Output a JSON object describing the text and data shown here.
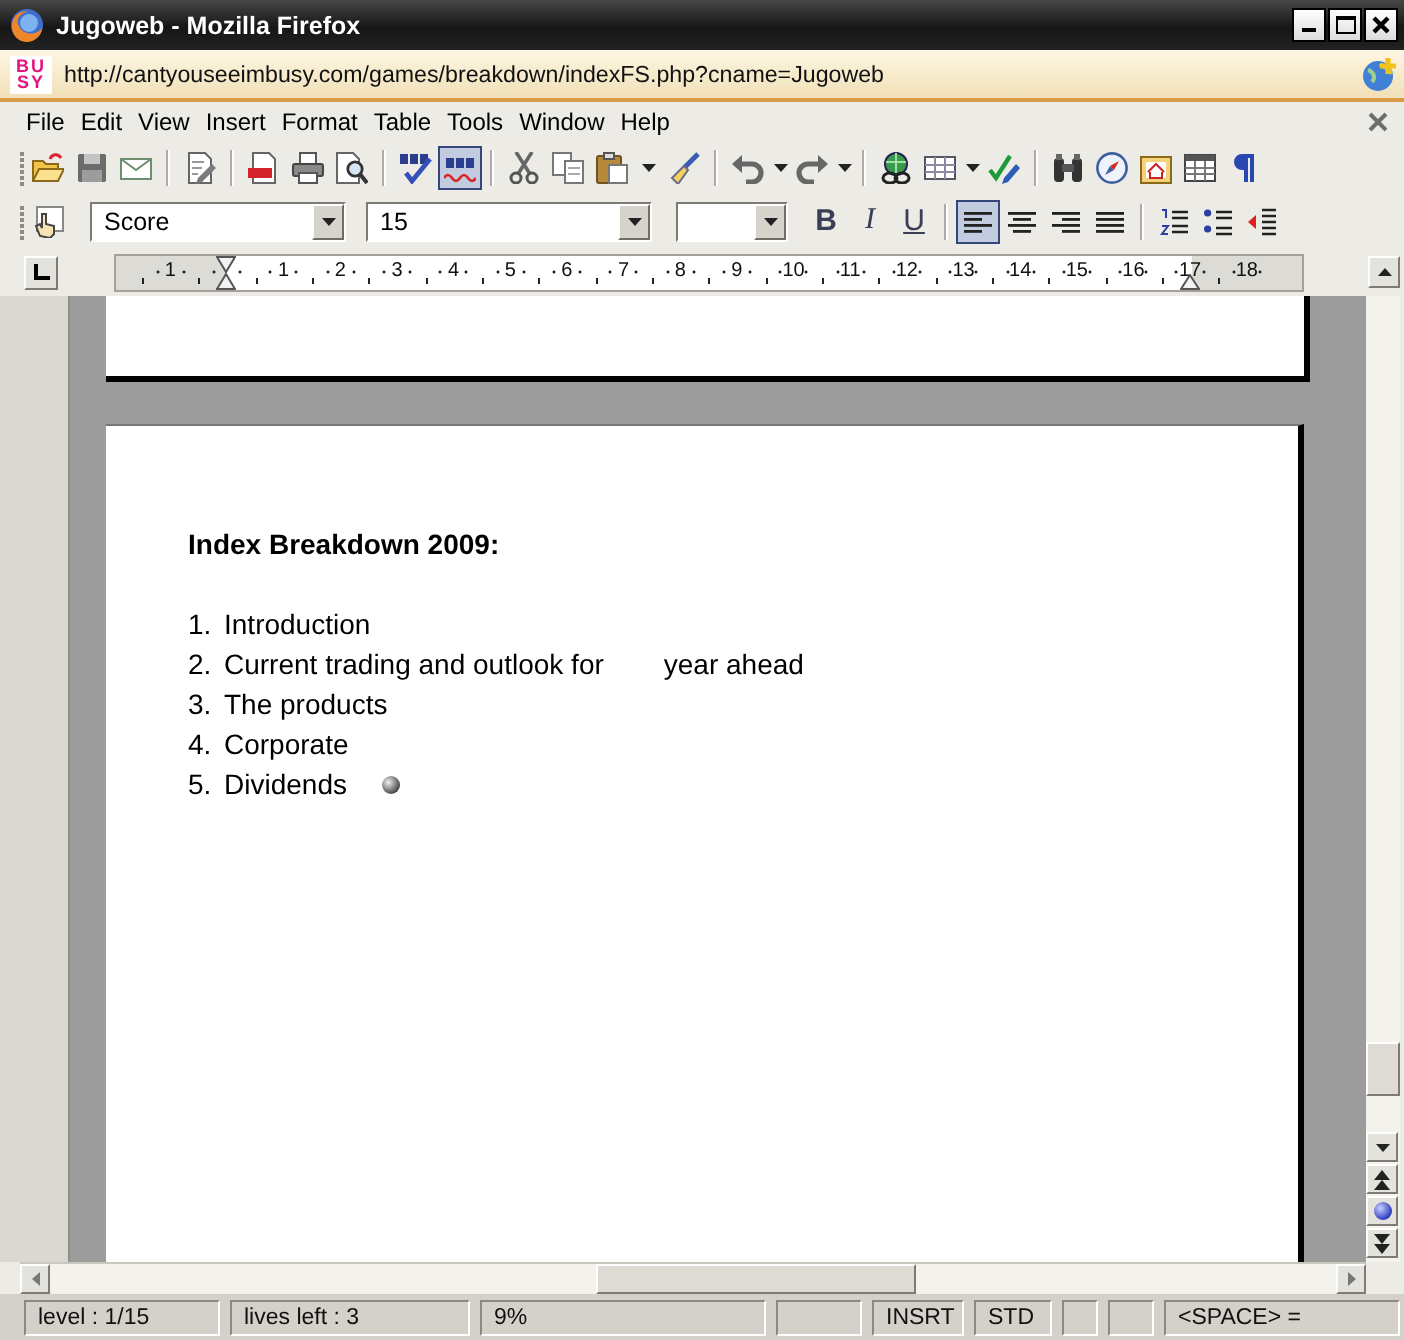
{
  "window": {
    "title": "Jugoweb - Mozilla Firefox"
  },
  "address_bar": {
    "site_logo": [
      "BU",
      "SY"
    ],
    "url": "http://cantyouseeimbusy.com/games/breakdown/indexFS.php?cname=Jugoweb"
  },
  "menu": [
    "File",
    "Edit",
    "View",
    "Insert",
    "Format",
    "Table",
    "Tools",
    "Window",
    "Help"
  ],
  "standard_toolbar": {
    "auto_spellcheck": {
      "on": true
    }
  },
  "formatting_toolbar": {
    "dropdowns": [
      {
        "value": "Score"
      },
      {
        "value": "15"
      }
    ],
    "text_styles": [
      {
        "kind": "bold",
        "label": "B",
        "on": false
      },
      {
        "kind": "italic",
        "label": "I",
        "on": false
      },
      {
        "kind": "underline",
        "label": "U",
        "on": false
      }
    ],
    "alignment": [
      {
        "kind": "left",
        "selected": true
      },
      {
        "kind": "center",
        "selected": false
      },
      {
        "kind": "right",
        "selected": false
      },
      {
        "kind": "justify",
        "selected": false
      }
    ]
  },
  "ruler": {
    "marks": [
      {
        "kind": "number",
        "label": "1"
      },
      {
        "kind": "indent"
      },
      {
        "kind": "number",
        "label": "1"
      },
      {
        "kind": "number",
        "label": "2"
      },
      {
        "kind": "number",
        "label": "3"
      },
      {
        "kind": "number",
        "label": "4"
      },
      {
        "kind": "number",
        "label": "5"
      },
      {
        "kind": "number",
        "label": "6"
      },
      {
        "kind": "number",
        "label": "7"
      },
      {
        "kind": "number",
        "label": "8"
      },
      {
        "kind": "number",
        "label": "9"
      },
      {
        "kind": "number",
        "label": "10"
      },
      {
        "kind": "number",
        "label": "11"
      },
      {
        "kind": "number",
        "label": "12"
      },
      {
        "kind": "number",
        "label": "13"
      },
      {
        "kind": "number",
        "label": "14"
      },
      {
        "kind": "number",
        "label": "15"
      },
      {
        "kind": "number",
        "label": "16"
      },
      {
        "kind": "indent_number",
        "label": "17"
      },
      {
        "kind": "number",
        "label": "18"
      }
    ]
  },
  "document": {
    "heading": "Index Breakdown 2009:",
    "items": [
      {
        "number": "1.",
        "text": "Introduction",
        "ball": false
      },
      {
        "number": "2.",
        "text": "Current trading and outlook for",
        "after_gap": "year ahead",
        "ball": false
      },
      {
        "number": "3.",
        "text": "The products",
        "ball": false
      },
      {
        "number": "4.",
        "text": "Corporate",
        "ball": false
      },
      {
        "number": "5.",
        "text": "Dividends",
        "ball": true
      }
    ]
  },
  "status_bar": [
    {
      "kind": "text",
      "text": "level : 1/15"
    },
    {
      "kind": "text",
      "text": "lives left : 3"
    },
    {
      "kind": "text",
      "text": "9%"
    },
    {
      "kind": "blank"
    },
    {
      "kind": "text",
      "text": "INSRT"
    },
    {
      "kind": "text",
      "text": "STD"
    },
    {
      "kind": "blank"
    },
    {
      "kind": "blank"
    },
    {
      "kind": "text",
      "text": "<SPACE> ="
    }
  ]
}
